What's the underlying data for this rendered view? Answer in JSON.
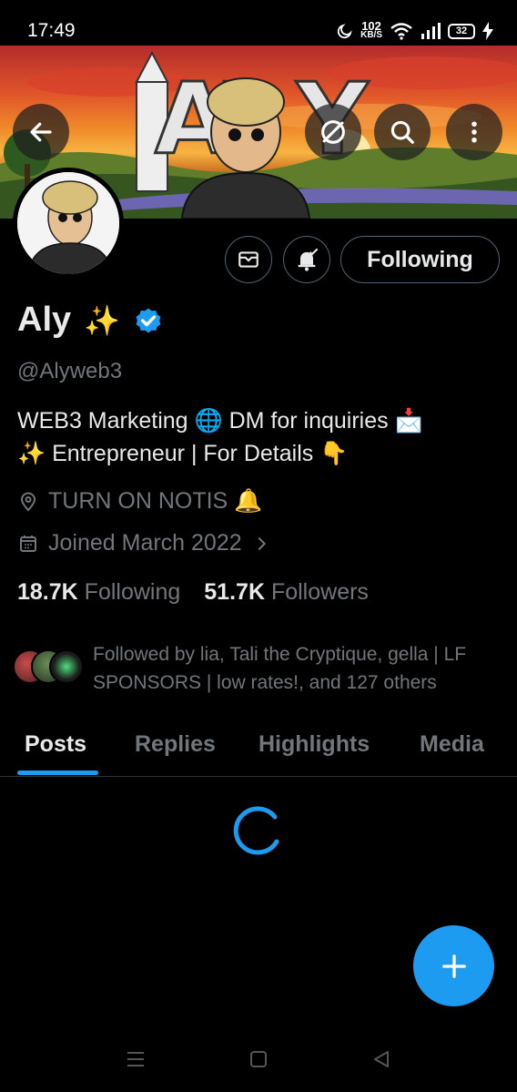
{
  "status_bar": {
    "time": "17:49",
    "net_speed_value": "102",
    "net_speed_unit": "KB/S",
    "battery": "32",
    "icons": [
      "moon-icon",
      "wifi-icon",
      "signal-icon",
      "battery-icon",
      "charging-icon"
    ]
  },
  "banner": {
    "description_icons": [
      "back-arrow-icon",
      "refresh-icon",
      "search-icon",
      "more-vertical-icon"
    ]
  },
  "profile": {
    "display_name": "Aly",
    "name_emoji": "✨",
    "handle": "@Alyweb3",
    "bio_line_1": "WEB3 Marketing 🌐 DM for inquiries 📩",
    "bio_line_2": "✨ Entrepreneur | For Details 👇",
    "location": "TURN ON NOTIS 🔔",
    "joined": "Joined March 2022",
    "following_count": "18.7K",
    "following_label": "Following",
    "followers_count": "51.7K",
    "followers_label": "Followers",
    "followed_by": "Followed by lia, Tali the Cryptique, gella | LF SPONSORS | low rates!, and 127 others"
  },
  "actions": {
    "following_button": "Following"
  },
  "tabs": [
    {
      "label": "Posts",
      "active": true
    },
    {
      "label": "Replies",
      "active": false
    },
    {
      "label": "Highlights",
      "active": false
    },
    {
      "label": "Media",
      "active": false
    }
  ],
  "colors": {
    "accent": "#1d9bf0",
    "background": "#000000",
    "text_primary": "#e7e9ea",
    "text_secondary": "#71767b",
    "border": "#536471"
  }
}
